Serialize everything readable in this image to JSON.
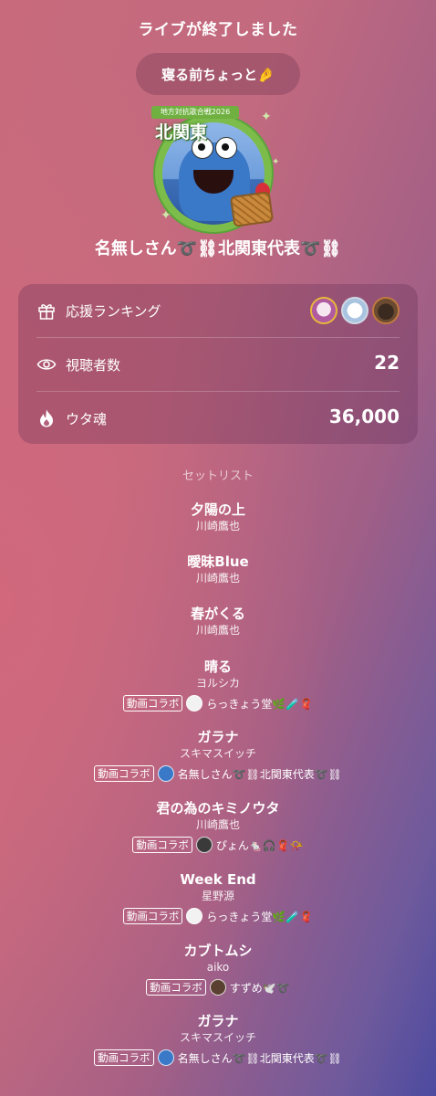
{
  "header": {
    "title": "ライブが終了しました"
  },
  "comment": {
    "text": "寝る前ちょっと🤌"
  },
  "avatar": {
    "banner": "地方対抗歌合戦2026",
    "region": "北関東"
  },
  "streamer": {
    "name": "名無しさん➰⛓北関東代表➰⛓"
  },
  "stats": {
    "ranking_label": "応援ランキング",
    "viewers_label": "視聴者数",
    "viewers_value": "22",
    "uta_label": "ウタ魂",
    "uta_value": "36,000"
  },
  "setlist": {
    "title": "セットリスト",
    "collab_label": "動画コラボ",
    "songs": [
      {
        "title": "夕陽の上",
        "artist": "川崎鷹也"
      },
      {
        "title": "曖昧Blue",
        "artist": "川崎鷹也"
      },
      {
        "title": "春がくる",
        "artist": "川崎鷹也"
      },
      {
        "title": "晴る",
        "artist": "ヨルシカ",
        "collab": "らっきょう堂🌿🧪🧣"
      },
      {
        "title": "ガラナ",
        "artist": "スキマスイッチ",
        "collab": "名無しさん➰⛓北関東代表➰⛓"
      },
      {
        "title": "君の為のキミノウタ",
        "artist": "川崎鷹也",
        "collab": "ぴょん🐁🎧🧣📯"
      },
      {
        "title": "Week End",
        "artist": "星野源",
        "collab": "らっきょう堂🌿🧪🧣"
      },
      {
        "title": "カブトムシ",
        "artist": "aiko",
        "collab": "すずめ🕊️➰"
      },
      {
        "title": "ガラナ",
        "artist": "スキマスイッチ",
        "collab": "名無しさん➰⛓北関東代表➰⛓"
      }
    ]
  },
  "colors": {
    "collab_avatar_rakkyo": "#f2f2f2",
    "collab_avatar_nanashi": "#3a78c8",
    "collab_avatar_pyon": "#3a3a3a",
    "collab_avatar_suzume": "#5a4030"
  }
}
